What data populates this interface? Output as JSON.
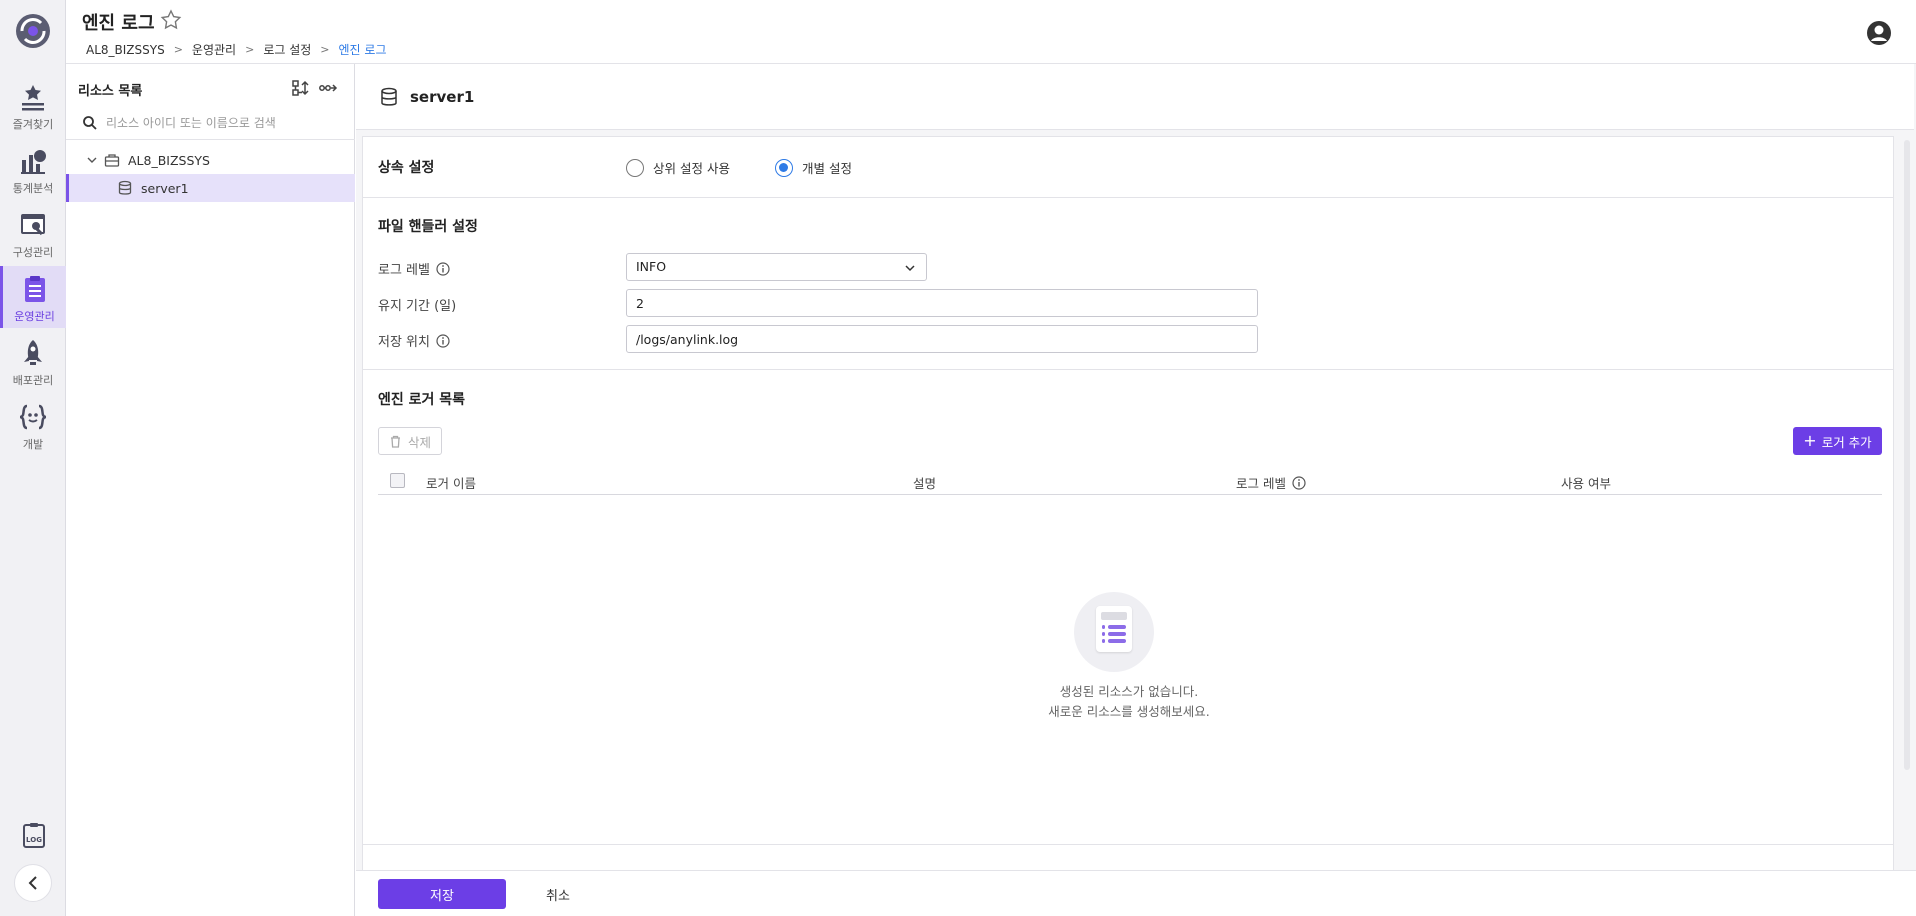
{
  "app": {
    "page_title": "엔진 로그"
  },
  "breadcrumb": [
    "AL8_BIZSSYS",
    "운영관리",
    "로그 설정",
    "엔진 로그"
  ],
  "rail": {
    "items": [
      {
        "label": "즐겨찾기",
        "icon": "star-list-icon"
      },
      {
        "label": "통계분석",
        "icon": "chart-icon"
      },
      {
        "label": "구성관리",
        "icon": "config-window-icon"
      },
      {
        "label": "운영관리",
        "icon": "clipboard-list-icon"
      },
      {
        "label": "배포관리",
        "icon": "rocket-icon"
      },
      {
        "label": "개발",
        "icon": "code-braces-icon"
      }
    ],
    "active": "운영관리"
  },
  "resource_panel": {
    "title": "리소스 목록",
    "search_placeholder": "리소스 아이디 또는 이름으로 검색",
    "tree": {
      "parent": "AL8_BIZSSYS",
      "child": "server1"
    }
  },
  "main": {
    "server_name": "server1",
    "inherit": {
      "title": "상속 설정",
      "option_parent": "상위 설정 사용",
      "option_individual": "개별 설정",
      "selected": "개별 설정"
    },
    "file_handler": {
      "title": "파일 핸들러 설정",
      "log_level_label": "로그 레벨",
      "log_level_value": "INFO",
      "retention_label": "유지 기간 (일)",
      "retention_value": "2",
      "location_label": "저장 위치",
      "location_value": "/logs/anylink.log"
    },
    "logger_list": {
      "title": "엔진 로거 목록",
      "delete_label": "삭제",
      "add_label": "로거 추가",
      "columns": [
        "로거 이름",
        "설명",
        "로그 레벨",
        "사용 여부"
      ],
      "empty_line1": "생성된 리소스가 없습니다.",
      "empty_line2": "새로운 리소스를 생성해보세요."
    }
  },
  "footer": {
    "save_label": "저장",
    "cancel_label": "취소"
  },
  "colors": {
    "accent": "#6c3ee6",
    "link": "#2f7be6",
    "active_bg": "#e6e1fa"
  }
}
